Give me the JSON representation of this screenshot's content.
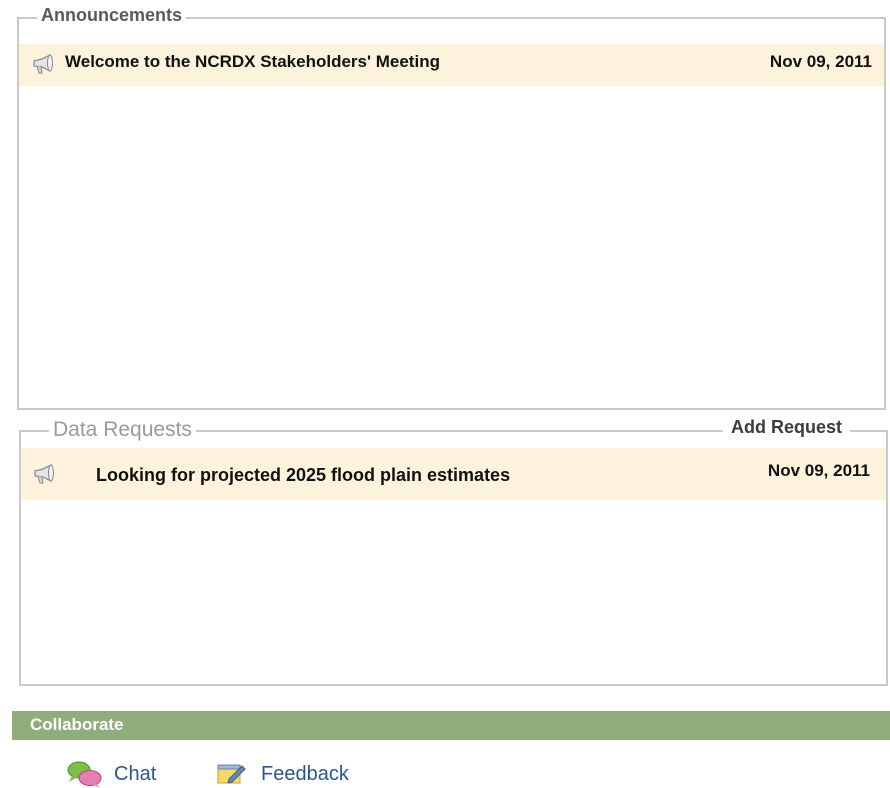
{
  "announcements": {
    "legend": "Announcements",
    "items": [
      {
        "icon": "megaphone-icon",
        "title": "Welcome to the NCRDX Stakeholders' Meeting",
        "date": "Nov 09, 2011"
      }
    ]
  },
  "data_requests": {
    "legend": "Data Requests",
    "add_label": "Add Request",
    "items": [
      {
        "icon": "megaphone-icon",
        "title": "Looking for projected 2025 flood plain estimates",
        "date": "Nov 09, 2011"
      }
    ]
  },
  "collaborate": {
    "title": "Collaborate",
    "links": [
      {
        "icon": "chat-bubbles-icon",
        "label": "Chat"
      },
      {
        "icon": "feedback-notepad-icon",
        "label": "Feedback"
      }
    ]
  },
  "colors": {
    "row_highlight": "#fdf2dc",
    "collab_bar": "#8fae7c",
    "link": "#2c5590",
    "border": "#c9c9c9"
  }
}
